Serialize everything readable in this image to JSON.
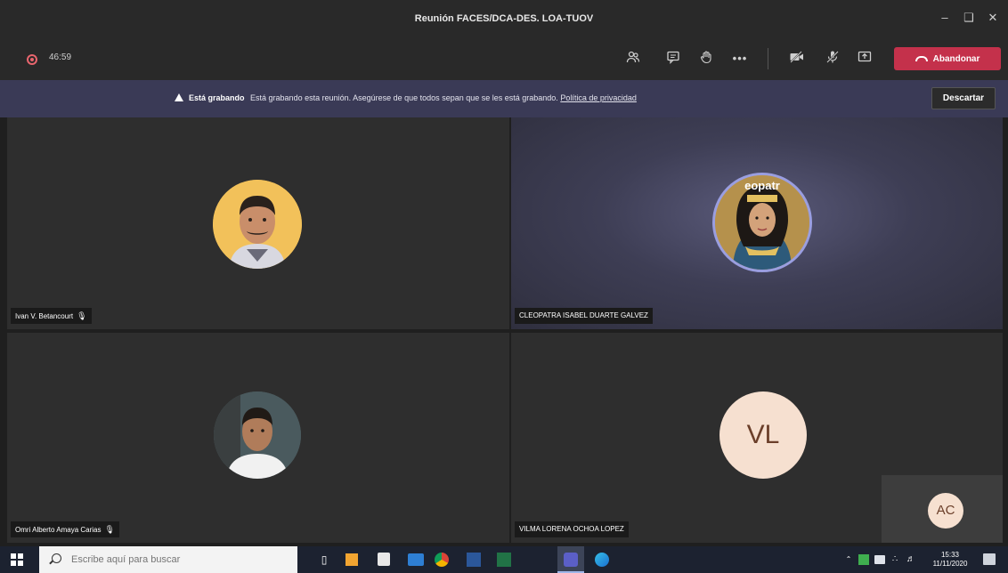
{
  "window": {
    "title": "Reunión FACES/DCA-DES. LOA-TUOV"
  },
  "toolbar": {
    "timer": "46:59",
    "leave_label": "Abandonar"
  },
  "banner": {
    "bold": "Está grabando",
    "message": "Está grabando esta reunión. Asegúrese de que todos sepan que se les está grabando.",
    "link": "Política de privacidad",
    "dismiss_label": "Descartar"
  },
  "participants": [
    {
      "name": "Ivan V. Betancourt",
      "initials": ""
    },
    {
      "name": "CLEOPATRA ISABEL DUARTE GALVEZ",
      "initials": "",
      "avatar_text": "eopatr"
    },
    {
      "name": "Omri Alberto Amaya Carias",
      "initials": ""
    },
    {
      "name": "VILMA LORENA OCHOA LOPEZ",
      "initials": "VL"
    }
  ],
  "self_view": {
    "initials": "AC"
  },
  "taskbar": {
    "search_placeholder": "Escribe aquí para buscar",
    "time": "15:33",
    "date": "11/11/2020"
  },
  "colors": {
    "leave": "#c4314b",
    "banner": "#3a3a56",
    "initials_bg": "#f6e0d0",
    "initials_text": "#6b3f2a"
  }
}
